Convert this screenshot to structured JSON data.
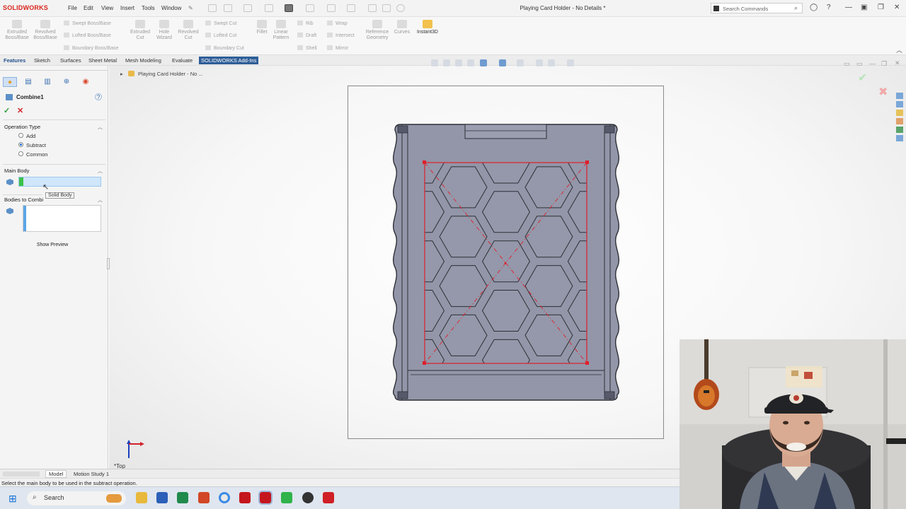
{
  "app": {
    "logo_text": "SOLIDWORKS",
    "menu": [
      "File",
      "Edit",
      "View",
      "Insert",
      "Tools",
      "Window"
    ],
    "document_title": "Playing Card Holder - No Details *",
    "search_placeholder": "Search Commands"
  },
  "ribbon": {
    "extruded_boss": "Extruded Boss/Base",
    "revolved_boss": "Revolved Boss/Base",
    "swept_boss": "Swept Boss/Base",
    "lofted_boss": "Lofted Boss/Base",
    "boundary_boss": "Boundary Boss/Base",
    "extruded_cut": "Extruded Cut",
    "hole_wizard": "Hole Wizard",
    "revolved_cut": "Revolved Cut",
    "swept_cut": "Swept Cut",
    "lofted_cut": "Lofted Cut",
    "boundary_cut": "Boundary Cut",
    "fillet": "Fillet",
    "linear_pattern": "Linear Pattern",
    "rib": "Rib",
    "draft": "Draft",
    "shell": "Shell",
    "wrap": "Wrap",
    "intersect": "Intersect",
    "mirror": "Mirror",
    "reference_geometry": "Reference Geometry",
    "curves": "Curves",
    "instant3d": "Instant3D"
  },
  "tabs": [
    "Features",
    "Sketch",
    "Surfaces",
    "Sheet Metal",
    "Mesh Modeling",
    "Evaluate",
    "SOLIDWORKS Add-Ins"
  ],
  "property_manager": {
    "feature_name": "Combine1",
    "operation_type": {
      "heading": "Operation Type",
      "options": [
        "Add",
        "Subtract",
        "Common"
      ],
      "selected": "Subtract"
    },
    "main_body": {
      "heading": "Main Body",
      "tooltip": "Solid Body"
    },
    "bodies_to_combine": {
      "heading": "Bodies to Combi"
    },
    "show_preview_label": "Show Preview"
  },
  "graphics": {
    "tree_breadcrumb": "Playing Card Holder - No ...",
    "view_label": "*Top"
  },
  "bottom_tabs": [
    "Model",
    "Motion Study 1"
  ],
  "status_text": "Select the main body to be used in the subtract operation.",
  "taskbar": {
    "search_label": "Search"
  },
  "colors": {
    "accent": "#1f4f8a",
    "sketch_red": "#e01f2b",
    "part_gray": "#8e92a3",
    "selection_green": "#3bc14a"
  }
}
